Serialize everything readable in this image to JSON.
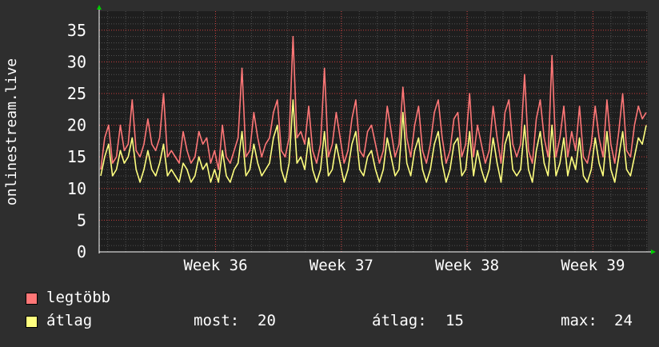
{
  "chart_data": {
    "type": "line",
    "ylabel": "onlinestream.live",
    "ylim": [
      0,
      38
    ],
    "yticks": [
      0,
      5,
      10,
      15,
      20,
      25,
      30,
      35
    ],
    "x_tick_labels": [
      "Week 36",
      "Week 37",
      "Week 38",
      "Week 39"
    ],
    "grid": true,
    "colors": {
      "background": "#2e2e2e",
      "plot_background": "#1e1e1e",
      "grid_major": "#c83c3c",
      "grid_minor": "#505050",
      "axis_arrow": "#00cc00"
    },
    "series": [
      {
        "name": "legtöbb",
        "color": "#ff7777",
        "values": [
          13,
          18,
          20,
          14,
          15,
          20,
          16,
          17,
          24,
          16,
          15,
          17,
          21,
          17,
          16,
          18,
          25,
          15,
          16,
          15,
          14,
          19,
          16,
          14,
          15,
          19,
          17,
          18,
          14,
          16,
          13,
          20,
          15,
          14,
          16,
          18,
          29,
          15,
          16,
          22,
          18,
          15,
          17,
          18,
          22,
          24,
          16,
          15,
          18,
          34,
          18,
          19,
          17,
          23,
          16,
          14,
          17,
          29,
          15,
          17,
          22,
          18,
          14,
          16,
          21,
          24,
          16,
          15,
          19,
          20,
          17,
          14,
          16,
          23,
          19,
          15,
          17,
          26,
          18,
          15,
          20,
          23,
          16,
          14,
          17,
          22,
          24,
          18,
          14,
          16,
          21,
          22,
          15,
          17,
          25,
          15,
          20,
          17,
          14,
          16,
          23,
          18,
          14,
          22,
          24,
          17,
          15,
          17,
          28,
          16,
          14,
          21,
          24,
          18,
          15,
          31,
          15,
          18,
          23,
          15,
          19,
          16,
          23,
          15,
          14,
          17,
          23,
          18,
          15,
          24,
          17,
          14,
          19,
          25,
          16,
          15,
          20,
          23,
          21,
          22
        ]
      },
      {
        "name": "átlag",
        "color": "#ffff7f",
        "values": [
          12,
          15,
          17,
          12,
          13,
          16,
          14,
          15,
          18,
          13,
          11,
          13,
          16,
          13,
          12,
          14,
          17,
          12,
          13,
          12,
          11,
          14,
          13,
          11,
          12,
          15,
          13,
          14,
          11,
          13,
          11,
          16,
          12,
          11,
          13,
          14,
          19,
          12,
          13,
          17,
          14,
          12,
          13,
          14,
          18,
          20,
          13,
          11,
          14,
          24,
          14,
          15,
          13,
          18,
          13,
          11,
          13,
          19,
          12,
          13,
          17,
          14,
          11,
          13,
          17,
          19,
          13,
          12,
          15,
          16,
          13,
          11,
          13,
          18,
          15,
          12,
          13,
          22,
          14,
          12,
          16,
          18,
          13,
          11,
          13,
          17,
          19,
          14,
          11,
          13,
          17,
          18,
          12,
          13,
          19,
          12,
          16,
          13,
          11,
          13,
          18,
          14,
          11,
          17,
          19,
          13,
          12,
          13,
          20,
          13,
          11,
          16,
          19,
          14,
          12,
          20,
          12,
          14,
          18,
          12,
          15,
          13,
          18,
          12,
          11,
          13,
          18,
          14,
          12,
          19,
          13,
          11,
          15,
          19,
          13,
          12,
          15,
          18,
          17,
          20
        ]
      }
    ]
  },
  "legend": {
    "max_label": "legtöbb",
    "avg_label": "átlag",
    "stats": [
      {
        "key": "most:",
        "value": "20"
      },
      {
        "key": "átlag:",
        "value": "15"
      },
      {
        "key": "max:",
        "value": "24"
      }
    ]
  }
}
